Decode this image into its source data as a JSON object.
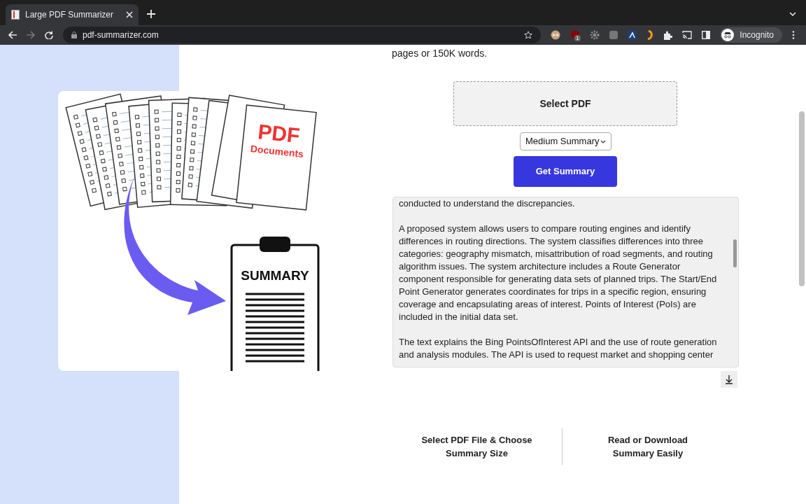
{
  "browser": {
    "tab": {
      "title": "Large PDF Summarizer",
      "selected": true
    },
    "url": "pdf-summarizer.com",
    "profile": "Incognito",
    "extension_badge": "1"
  },
  "illustration": {
    "document_label_1": "PDF",
    "document_label_2": "Documents",
    "clipboard_label": "SUMMARY"
  },
  "intro_tail": "pages or 150K words.",
  "select_button": "Select PDF",
  "summary_size": {
    "value": "Medium Summary"
  },
  "get_summary_button": "Get Summary",
  "summary_paragraphs": [
    "conducted to understand the discrepancies.",
    "A proposed system allows users to compare routing engines and identify differences in routing directions. The system classifies differences into three categories: geography mismatch, misattribution of road segments, and routing algorithm issues. The system architecture includes a Route Generator component responsible for generating data sets of planned trips. The Start/End Point Generator generates coordinates for trips in a specific region, ensuring coverage and encapsulating areas of interest. Points of Interest (PoIs) are included in the initial data set.",
    "The text explains the Bing PointsOfInterest API and the use of route generation and analysis modules. The API is used to request market and shopping center"
  ],
  "steps": [
    {
      "title": "Select PDF File & Choose Summary Size"
    },
    {
      "title": "Read or Download Summary Easily"
    }
  ]
}
